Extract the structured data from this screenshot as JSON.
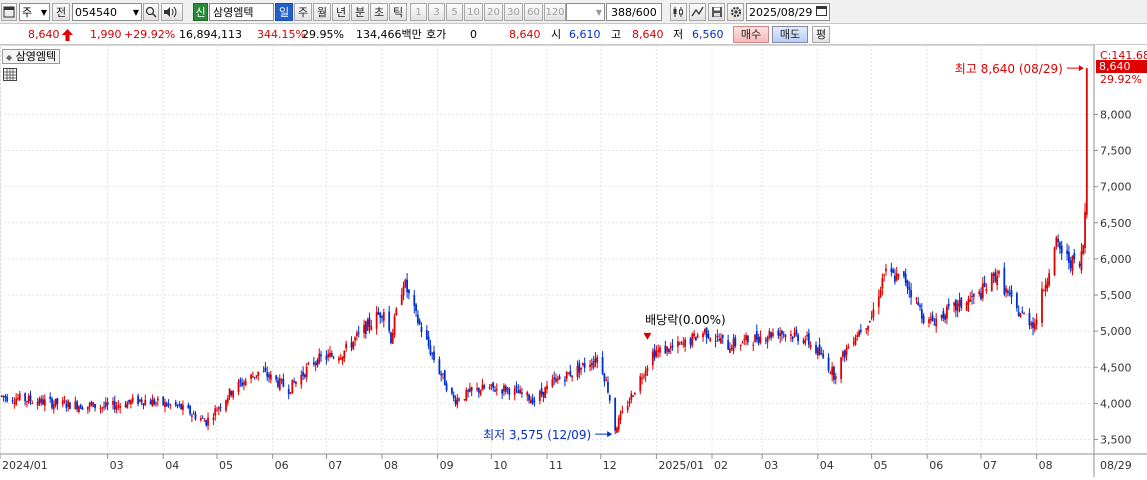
{
  "toolbar": {
    "market_label": "주",
    "prev_label": "전",
    "stock_code": "054540",
    "credit_badge": "신",
    "stock_name": "삼영엠텍",
    "period_tabs": [
      "일",
      "주",
      "월",
      "년",
      "분",
      "초",
      "틱"
    ],
    "active_tab": "일",
    "interval_buttons": [
      "1",
      "3",
      "5",
      "10",
      "20",
      "30",
      "60",
      "120"
    ],
    "count_value": "388",
    "count_max": "/600",
    "date_value": "2025/08/29",
    "icons": [
      "window-icon",
      "search-icon",
      "sound-icon",
      "chart-type-icon",
      "line-tool-icon",
      "save-icon",
      "settings-icon",
      "calendar-icon"
    ]
  },
  "quote": {
    "price": "8,640",
    "change": "1,990",
    "change_pct": "+29.92%",
    "volume": "16,894,113",
    "volume_ratio": "344.15%",
    "turnover": "29.95%",
    "amount": "134,466백만",
    "hoga_label": "호가",
    "hoga_value": "0",
    "hoga_price": "8,640",
    "open_label": "시",
    "open_value": "6,610",
    "high_label": "고",
    "high_value": "8,640",
    "low_label": "저",
    "low_value": "6,560",
    "buy_label": "매수",
    "sell_label": "매도",
    "eval_label": "평"
  },
  "chart_panel": {
    "title": "삼영엠텍",
    "current_label": "C:141.68",
    "current_price_tag": "8,640",
    "current_pct_tag": "29.92%",
    "colors": {
      "up": "#e00000",
      "down": "#0030d0",
      "grid": "#e4e4e4",
      "tag": "#e00000"
    }
  },
  "chart_data": {
    "type": "candlestick",
    "y_ticks": [
      3500,
      4000,
      4500,
      5000,
      5500,
      6000,
      6500,
      7000,
      7500,
      8000
    ],
    "y_tick_labels": [
      "3,500",
      "4,000",
      "4,500",
      "5,000",
      "5,500",
      "6,000",
      "6,500",
      "7,000",
      "7,500",
      "8,000"
    ],
    "ylim": [
      3300,
      8850
    ],
    "x_labels": [
      "2024/01",
      "03",
      "04",
      "05",
      "06",
      "07",
      "08",
      "09",
      "10",
      "11",
      "12",
      "2025/01",
      "02",
      "03",
      "04",
      "05",
      "06",
      "07",
      "08",
      "08/29"
    ],
    "x_label_months": [
      "2024-01",
      "2024-03",
      "2024-04",
      "2024-05",
      "2024-06",
      "2024-07",
      "2024-08",
      "2024-09",
      "2024-10",
      "2024-11",
      "2024-12",
      "2025-01",
      "2025-02",
      "2025-03",
      "2025-04",
      "2025-05",
      "2025-06",
      "2025-07",
      "2025-08",
      "2025-08-29"
    ],
    "close_trend": [
      [
        "2024-01-02",
        4100
      ],
      [
        "2024-02-01",
        4000
      ],
      [
        "2024-03-01",
        3950
      ],
      [
        "2024-03-20",
        4050
      ],
      [
        "2024-04-10",
        3950
      ],
      [
        "2024-04-25",
        3750
      ],
      [
        "2024-05-10",
        4200
      ],
      [
        "2024-05-25",
        4450
      ],
      [
        "2024-06-10",
        4200
      ],
      [
        "2024-06-25",
        4600
      ],
      [
        "2024-07-10",
        4700
      ],
      [
        "2024-07-25",
        5100
      ],
      [
        "2024-08-02",
        5300
      ],
      [
        "2024-08-06",
        4900
      ],
      [
        "2024-08-13",
        5700
      ],
      [
        "2024-08-20",
        5200
      ],
      [
        "2024-09-01",
        4500
      ],
      [
        "2024-09-10",
        4050
      ],
      [
        "2024-09-25",
        4200
      ],
      [
        "2024-10-10",
        4200
      ],
      [
        "2024-10-25",
        4050
      ],
      [
        "2024-11-05",
        4300
      ],
      [
        "2024-11-20",
        4500
      ],
      [
        "2024-11-30",
        4650
      ],
      [
        "2024-12-05",
        4200
      ],
      [
        "2024-12-09",
        3650
      ],
      [
        "2024-12-20",
        4200
      ],
      [
        "2024-12-30",
        4700
      ],
      [
        "2025-01-15",
        4800
      ],
      [
        "2025-01-28",
        5000
      ],
      [
        "2025-02-10",
        4800
      ],
      [
        "2025-02-25",
        4900
      ],
      [
        "2025-03-10",
        5000
      ],
      [
        "2025-03-25",
        4900
      ],
      [
        "2025-04-05",
        4600
      ],
      [
        "2025-04-10",
        4400
      ],
      [
        "2025-04-20",
        4900
      ],
      [
        "2025-05-01",
        5200
      ],
      [
        "2025-05-08",
        5800
      ],
      [
        "2025-05-20",
        5700
      ],
      [
        "2025-06-01",
        5100
      ],
      [
        "2025-06-15",
        5300
      ],
      [
        "2025-06-30",
        5500
      ],
      [
        "2025-07-10",
        5800
      ],
      [
        "2025-07-20",
        5300
      ],
      [
        "2025-07-31",
        5100
      ],
      [
        "2025-08-06",
        5700
      ],
      [
        "2025-08-12",
        6200
      ],
      [
        "2025-08-18",
        6000
      ],
      [
        "2025-08-25",
        5900
      ],
      [
        "2025-08-27",
        6200
      ],
      [
        "2025-08-28",
        6650
      ],
      [
        "2025-08-29",
        8640
      ]
    ],
    "annotations": [
      {
        "text": "최고 8,640 (08/29)",
        "date": "2025-08-29",
        "value": 8640,
        "color": "#e00000"
      },
      {
        "text": "최저 3,575 (12/09)",
        "date": "2024-12-09",
        "value": 3575,
        "color": "#0030c8"
      },
      {
        "text": "배당락(0.00%)",
        "date": "2024-12-27",
        "value": 4810,
        "color": "#000000"
      }
    ]
  }
}
